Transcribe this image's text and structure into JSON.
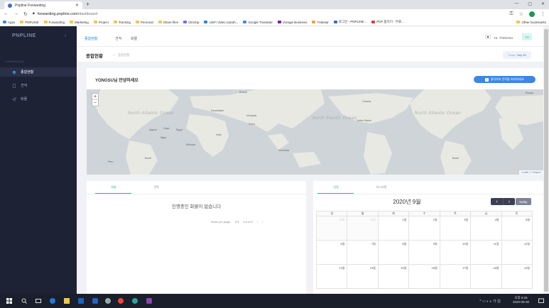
{
  "browser": {
    "tab_title": "Pnpline Forwarding",
    "url_host": "forwarding.pnpline.com",
    "url_path": "/dashboard",
    "bookmarks": [
      "Apps",
      "PNPLINE",
      "Forwarding",
      "Marketing",
      "Project",
      "Tracking",
      "Personal",
      "Share files",
      "ClickUp",
      "UniFi Video (sarah...",
      "Google Translate",
      "Vonage Business",
      "Trakstar",
      "로그인 - PNPLINE...",
      "PDF 합치기 - 무료..."
    ],
    "other_bookmarks": "Other bookmarks"
  },
  "sidebar": {
    "logo": "PNPLINE",
    "section": "FORWARDING",
    "items": [
      {
        "label": "종합현황",
        "active": true
      },
      {
        "label": "견적",
        "active": false
      },
      {
        "label": "화물",
        "active": false
      }
    ]
  },
  "topnav": {
    "items": [
      "종합현황",
      "견적",
      "화물"
    ],
    "active_index": 0,
    "user": "Hi, YONGSU",
    "avatar": "YH"
  },
  "subheader": {
    "title": "종합현황",
    "breadcrumb": "종합현황",
    "today_label": "Today",
    "today_value": "Sep 30"
  },
  "map_card": {
    "greeting": "YONGSU님 안녕하세요",
    "register_button": "클릭하여 견적을 의뢰하세요!",
    "attribution": "Leaflet | © Mapbox",
    "labels": [
      {
        "text": "North Atlantic Ocean"
      },
      {
        "text": "North Pacific Ocean"
      },
      {
        "text": "North Atlantic Ocean"
      },
      {
        "text": "Russia"
      },
      {
        "text": "Russia"
      },
      {
        "text": "Canada"
      },
      {
        "text": "United States"
      },
      {
        "text": "China"
      },
      {
        "text": "Kazakhstan"
      },
      {
        "text": "Mongolia"
      },
      {
        "text": "India"
      },
      {
        "text": "Brazil"
      },
      {
        "text": "Brazil"
      },
      {
        "text": "Algeria"
      },
      {
        "text": "Libya"
      },
      {
        "text": "Egypt"
      },
      {
        "text": "Niger"
      },
      {
        "text": "Ethiopia"
      },
      {
        "text": "Indonesia"
      },
      {
        "text": "Peru"
      }
    ]
  },
  "cargo_card": {
    "tabs": [
      "화물",
      "견적"
    ],
    "active_tab": 0,
    "empty_message": "진행중인 화물이 없습니다",
    "rows_label": "Rows per page:",
    "rows_value": "5",
    "range": "0-0 of 0"
  },
  "calendar": {
    "tabs": [
      "일정",
      "지시사항"
    ],
    "active_tab": 0,
    "title": "2020년 9월",
    "prev": "‹",
    "next": "›",
    "today": "today",
    "weekdays": [
      "일",
      "월",
      "화",
      "수",
      "목",
      "금",
      "토"
    ],
    "weeks": [
      [
        {
          "d": "30일",
          "o": true
        },
        {
          "d": "31일",
          "o": true
        },
        {
          "d": "1일"
        },
        {
          "d": "2일"
        },
        {
          "d": "3일"
        },
        {
          "d": "4일"
        },
        {
          "d": "5일"
        }
      ],
      [
        {
          "d": "6일"
        },
        {
          "d": "7일"
        },
        {
          "d": "8일"
        },
        {
          "d": "9일"
        },
        {
          "d": "10일"
        },
        {
          "d": "11일"
        },
        {
          "d": "12일"
        }
      ],
      [
        {
          "d": "13일"
        },
        {
          "d": "14일"
        },
        {
          "d": "15일"
        },
        {
          "d": "16일"
        },
        {
          "d": "17일"
        },
        {
          "d": "18일"
        },
        {
          "d": "19일"
        }
      ]
    ]
  },
  "taskbar": {
    "time": "오후 6:26",
    "date": "2020-09-30"
  }
}
